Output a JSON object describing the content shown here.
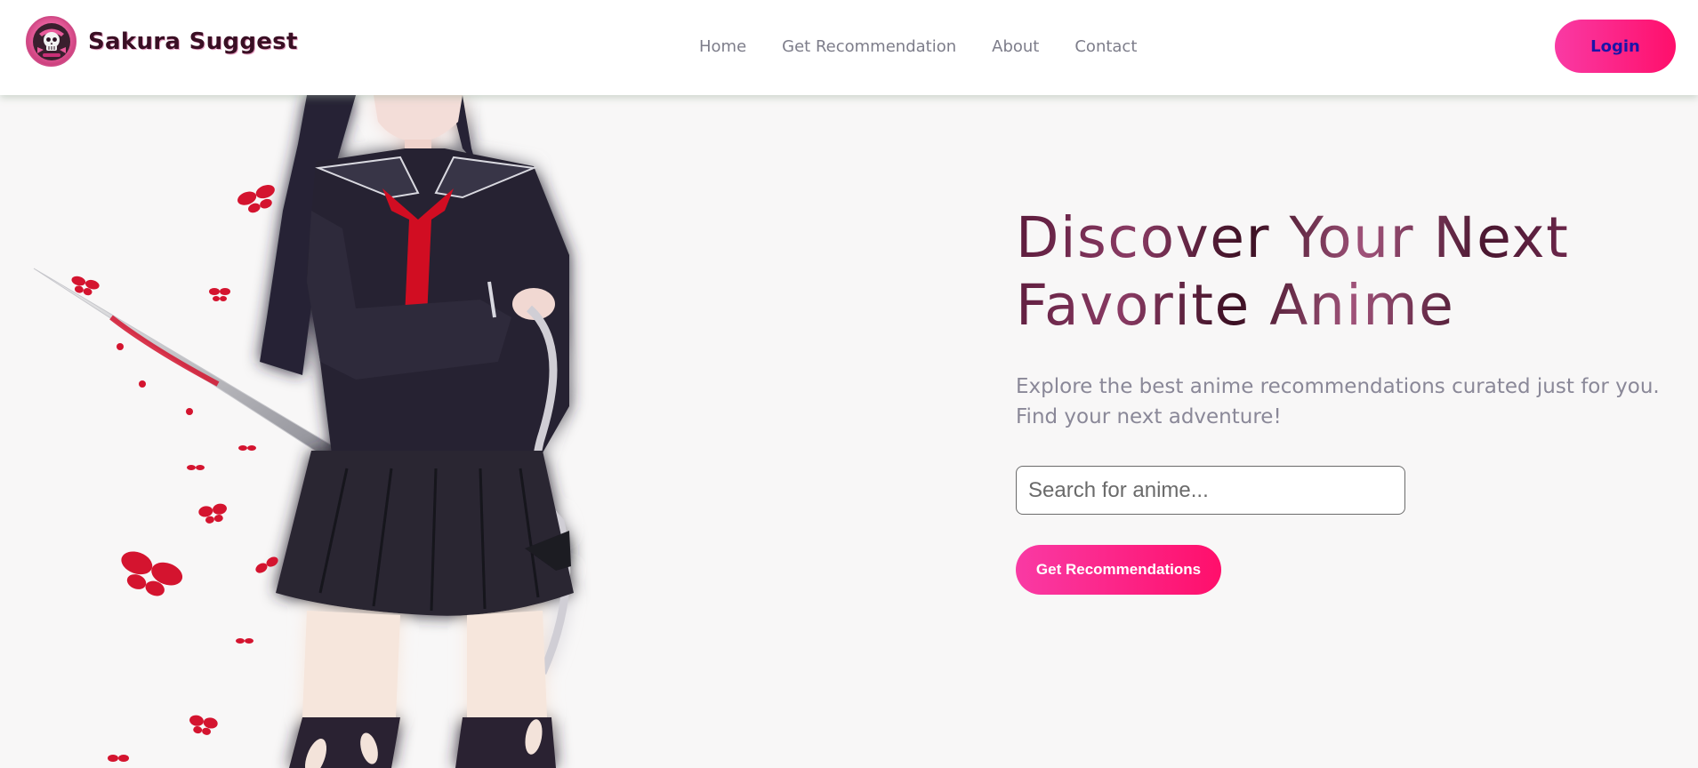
{
  "nav": {
    "brand_name": "Sakura Suggest",
    "links": [
      {
        "label": "Home"
      },
      {
        "label": "Get Recommendation"
      },
      {
        "label": "About"
      },
      {
        "label": "Contact"
      }
    ],
    "login_label": "Login"
  },
  "hero": {
    "title": "Discover Your Next Favorite Anime",
    "subtitle": "Explore the best anime recommendations curated just for you. Find your next adventure!",
    "search_placeholder": "Search for anime...",
    "search_value": "",
    "cta_label": "Get Recommendations",
    "illustration": "anime-girl-with-katana-and-red-butterflies"
  },
  "colors": {
    "accent_gradient_start": "#f93aa4",
    "accent_gradient_end": "#ff0f6b",
    "brand_text": "#3a0f24",
    "nav_link": "#7d7d8a",
    "login_text": "#1c14a8",
    "page_background": "#f8f7f7"
  }
}
